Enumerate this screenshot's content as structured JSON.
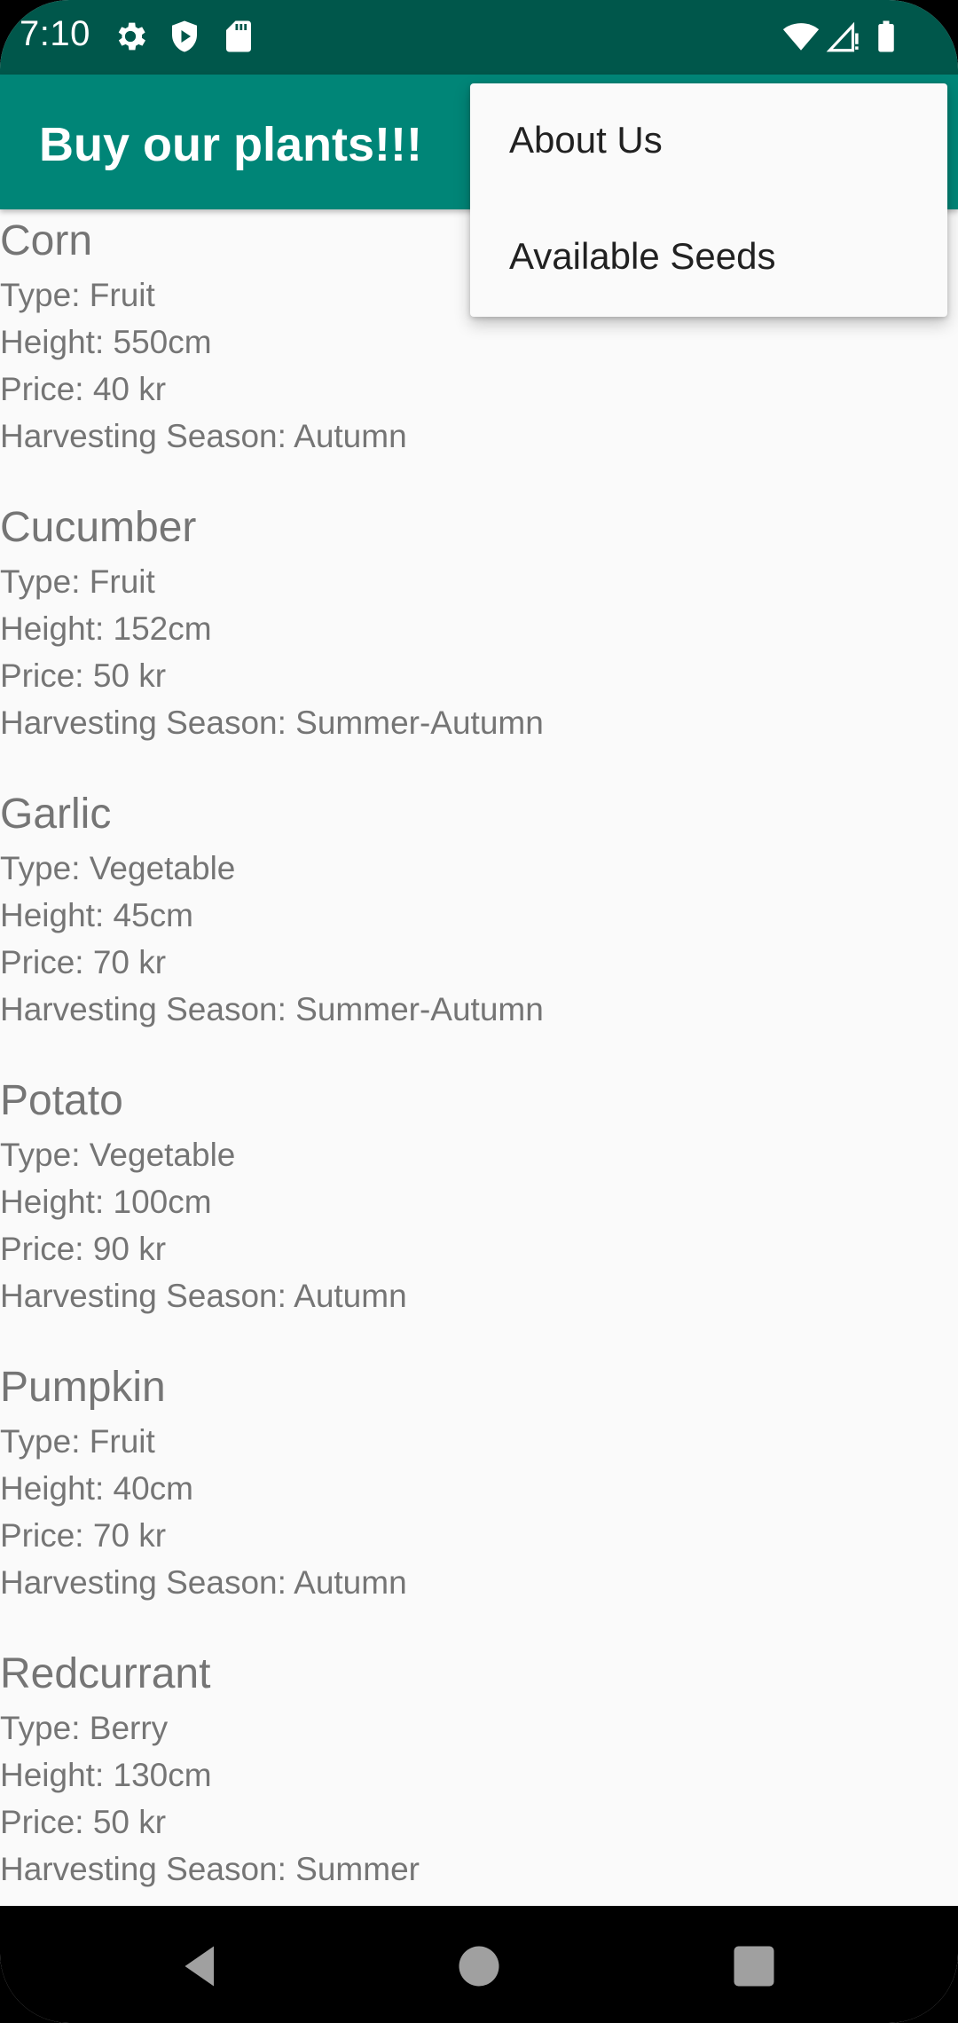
{
  "status_bar": {
    "time": "7:10",
    "icons": [
      "gear-icon",
      "shield-icon",
      "sd-card-icon",
      "wifi-icon",
      "signal-icon",
      "battery-icon"
    ]
  },
  "app_bar": {
    "title": "Buy our plants!!!"
  },
  "overflow_menu": {
    "items": [
      {
        "label": "About Us"
      },
      {
        "label": "Available Seeds"
      }
    ]
  },
  "plants": [
    {
      "name": "Corn",
      "type": "Type: Fruit",
      "height": "Height: 550cm",
      "price": "Price: 40 kr",
      "season": "Harvesting Season: Autumn"
    },
    {
      "name": "Cucumber",
      "type": "Type: Fruit",
      "height": "Height: 152cm",
      "price": "Price: 50 kr",
      "season": "Harvesting Season: Summer-Autumn"
    },
    {
      "name": "Garlic",
      "type": "Type: Vegetable",
      "height": "Height: 45cm",
      "price": "Price: 70 kr",
      "season": "Harvesting Season: Summer-Autumn"
    },
    {
      "name": "Potato",
      "type": "Type: Vegetable",
      "height": "Height: 100cm",
      "price": "Price: 90 kr",
      "season": "Harvesting Season: Autumn"
    },
    {
      "name": "Pumpkin",
      "type": "Type: Fruit",
      "height": "Height: 40cm",
      "price": "Price: 70 kr",
      "season": "Harvesting Season: Autumn"
    },
    {
      "name": "Redcurrant",
      "type": "Type: Berry",
      "height": "Height: 130cm",
      "price": "Price: 50 kr",
      "season": "Harvesting Season: Summer"
    }
  ],
  "nav_bar": {
    "icons": [
      "back-icon",
      "home-icon",
      "recents-icon"
    ]
  },
  "colors": {
    "status_bar": "#00574b",
    "app_bar": "#008577",
    "text_secondary": "#757575"
  }
}
